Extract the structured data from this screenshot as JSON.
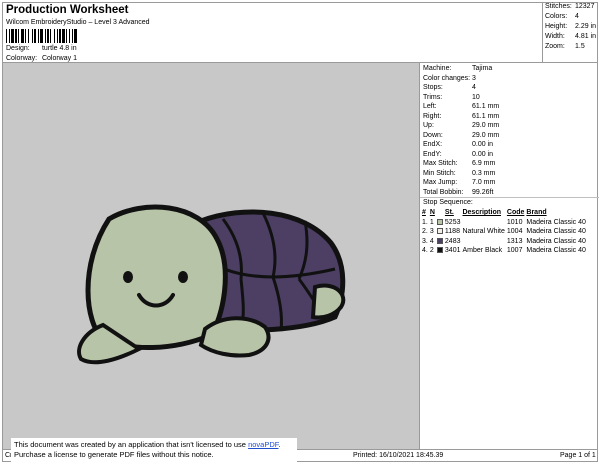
{
  "header": {
    "title": "Production Worksheet",
    "software": "Wilcom EmbroideryStudio – Level 3 Advanced",
    "design_label": "Design:",
    "design_value": "turtle 4.8 in",
    "colorway_label": "Colorway:",
    "colorway_value": "Colorway 1"
  },
  "summary": {
    "stitches_label": "Stitches:",
    "stitches": "12327",
    "colors_label": "Colors:",
    "colors": "4",
    "height_label": "Height:",
    "height": "2.29 in",
    "width_label": "Width:",
    "width": "4.81 in",
    "zoom_label": "Zoom:",
    "zoom": "1.5"
  },
  "machine": {
    "machine_label": "Machine:",
    "machine": "Tajima",
    "color_changes_label": "Color changes:",
    "color_changes": "3",
    "stops_label": "Stops:",
    "stops": "4",
    "trims_label": "Trims:",
    "trims": "10",
    "left_label": "Left:",
    "left": "61.1 mm",
    "right_label": "Right:",
    "right": "61.1 mm",
    "up_label": "Up:",
    "up": "29.0 mm",
    "down_label": "Down:",
    "down": "29.0 mm",
    "endx_label": "EndX:",
    "endx": "0.00 in",
    "endy_label": "EndY:",
    "endy": "0.00 in",
    "max_stitch_label": "Max Stitch:",
    "max_stitch": "6.9 mm",
    "min_stitch_label": "Min Stitch:",
    "min_stitch": "0.3 mm",
    "max_jump_label": "Max Jump:",
    "max_jump": "7.0 mm",
    "total_bobbin_label": "Total Bobbin:",
    "total_bobbin": "99.26ft"
  },
  "stop_sequence": {
    "title": "Stop Sequence:",
    "headers": [
      "#",
      "N",
      "St.",
      "Description",
      "Code",
      "Brand"
    ],
    "rows": [
      {
        "num": "1.",
        "n": "1",
        "color": "#b8c4a8",
        "st": "5253",
        "desc": "",
        "code": "1010",
        "brand": "Madeira Classic 40"
      },
      {
        "num": "2.",
        "n": "3",
        "color": "#f2f0e6",
        "st": "1188",
        "desc": "Natural White",
        "code": "1004",
        "brand": "Madeira Classic 40"
      },
      {
        "num": "3.",
        "n": "4",
        "color": "#4c3f63",
        "st": "2483",
        "desc": "",
        "code": "1313",
        "brand": "Madeira Classic 40"
      },
      {
        "num": "4.",
        "n": "2",
        "color": "#111111",
        "st": "3401",
        "desc": "Amber Black",
        "code": "1007",
        "brand": "Madeira Classic 40"
      }
    ]
  },
  "footer": {
    "left": "Cr",
    "printed": "Printed: 16/10/2021 18:45.39",
    "page": "Page 1 of 1"
  },
  "notice": {
    "line1_pre": "This document was created by an application that isn't licensed to use ",
    "link": "novaPDF",
    "line1_post": ".",
    "line2": "Purchase a license to generate PDF files without this notice."
  }
}
